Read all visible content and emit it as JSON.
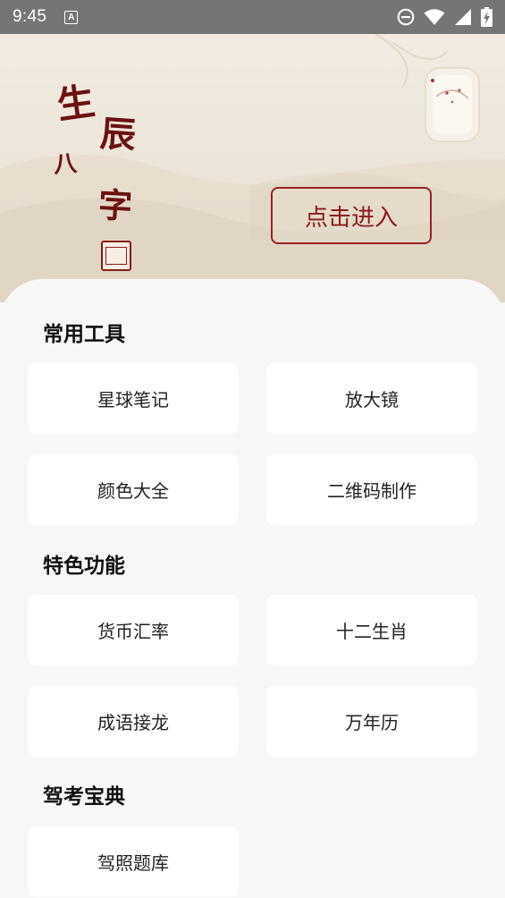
{
  "status_bar": {
    "time": "9:45",
    "notification_letter": "A",
    "icons": [
      "do-not-disturb-icon",
      "wifi-icon",
      "signal-icon",
      "battery-charging-icon"
    ]
  },
  "hero": {
    "title_chars": [
      "生",
      "辰",
      "八",
      "字"
    ],
    "enter_label": "点击进入",
    "accent_color": "#8b1a1a"
  },
  "sections": [
    {
      "title": "常用工具",
      "items": [
        "星球笔记",
        "放大镜",
        "颜色大全",
        "二维码制作"
      ]
    },
    {
      "title": "特色功能",
      "items": [
        "货币汇率",
        "十二生肖",
        "成语接龙",
        "万年历"
      ]
    },
    {
      "title": "驾考宝典",
      "items": [
        "驾照题库"
      ]
    }
  ]
}
